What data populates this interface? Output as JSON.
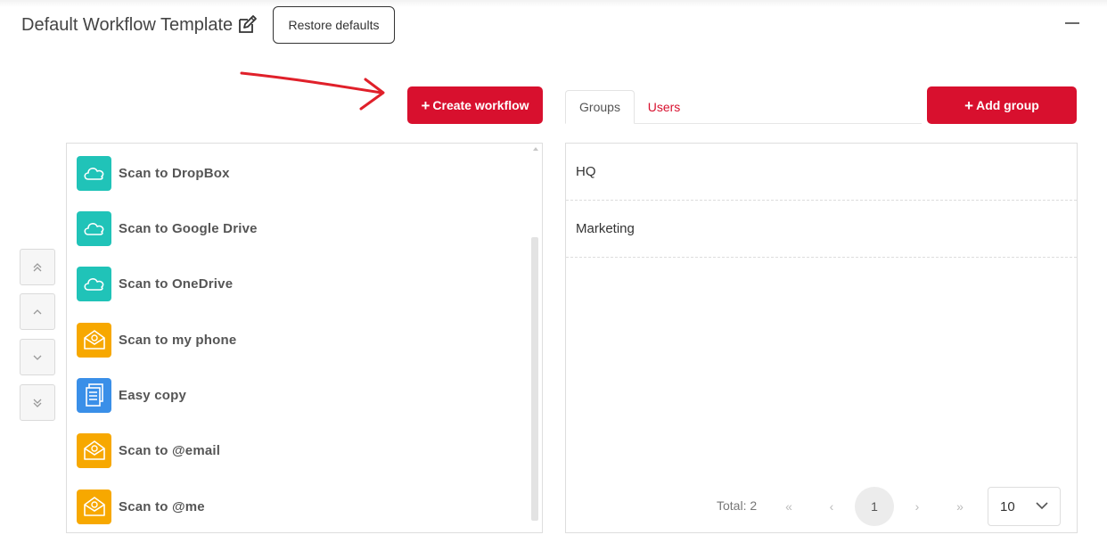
{
  "header": {
    "title": "Default Workflow Template",
    "restore_label": "Restore defaults",
    "edit_icon": "edit-icon",
    "collapse_icon": "minus-icon"
  },
  "toolbar": {
    "create_workflow_label": "Create workflow",
    "add_group_label": "Add group",
    "plus_glyph": "+"
  },
  "tabs": [
    {
      "label": "Groups",
      "active": true
    },
    {
      "label": "Users",
      "active": false
    }
  ],
  "workflows": [
    {
      "label": "Scan to DropBox",
      "icon": "cloud-icon",
      "color": "#20c3b8"
    },
    {
      "label": "Scan to Google Drive",
      "icon": "cloud-icon",
      "color": "#20c3b8"
    },
    {
      "label": "Scan to OneDrive",
      "icon": "cloud-icon",
      "color": "#20c3b8"
    },
    {
      "label": "Scan to my phone",
      "icon": "email-envelope-icon",
      "color": "#f7a800"
    },
    {
      "label": "Easy copy",
      "icon": "document-copy-icon",
      "color": "#3a8fe8"
    },
    {
      "label": "Scan to @email",
      "icon": "email-envelope-icon",
      "color": "#f7a800"
    },
    {
      "label": "Scan to @me",
      "icon": "email-envelope-icon",
      "color": "#f7a800"
    }
  ],
  "reorder_buttons": [
    {
      "icon": "double-chevron-up-icon"
    },
    {
      "icon": "chevron-up-icon"
    },
    {
      "icon": "chevron-down-icon"
    },
    {
      "icon": "double-chevron-down-icon"
    }
  ],
  "groups": [
    {
      "name": "HQ"
    },
    {
      "name": "Marketing"
    }
  ],
  "pagination": {
    "total_label": "Total: 2",
    "first_glyph": "«",
    "prev_glyph": "‹",
    "current_page": "1",
    "next_glyph": "›",
    "last_glyph": "»",
    "page_size": "10"
  },
  "colors": {
    "accent": "#d8102e",
    "teal": "#20c3b8",
    "orange": "#f7a800",
    "blue": "#3a8fe8",
    "annotation_arrow": "#e0202a"
  }
}
